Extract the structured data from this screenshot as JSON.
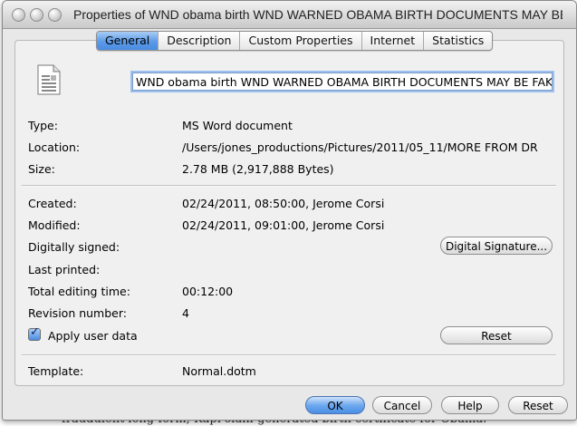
{
  "window": {
    "title": "Properties of WND obama birth WND WARNED OBAMA BIRTH DOCUMENTS MAY BE F..."
  },
  "tabs": [
    {
      "label": "General",
      "active": true
    },
    {
      "label": "Description",
      "active": false
    },
    {
      "label": "Custom Properties",
      "active": false
    },
    {
      "label": "Internet",
      "active": false
    },
    {
      "label": "Statistics",
      "active": false
    }
  ],
  "document": {
    "icon": "document-icon",
    "name_value": "WND obama birth WND WARNED OBAMA BIRTH DOCUMENTS MAY BE FAKE"
  },
  "info": {
    "type_label": "Type:",
    "type_value": "MS Word document",
    "location_label": "Location:",
    "location_value": "/Users/jones_productions/Pictures/2011/05_11/MORE FROM DR",
    "size_label": "Size:",
    "size_value": "2.78 MB (2,917,888 Bytes)"
  },
  "dates": {
    "created_label": "Created:",
    "created_value": "02/24/2011, 08:50:00, Jerome Corsi",
    "modified_label": "Modified:",
    "modified_value": "02/24/2011, 09:01:00, Jerome Corsi",
    "signed_label": "Digitally signed:",
    "signature_button": "Digital Signature...",
    "printed_label": "Last printed:",
    "editing_label": "Total editing time:",
    "editing_value": "00:12:00",
    "revision_label": "Revision number:",
    "revision_value": "4",
    "apply_user_data_label": "Apply user data",
    "apply_user_data_checked": true,
    "reset_label": "Reset"
  },
  "template": {
    "label": "Template:",
    "value": "Normal.dotm"
  },
  "footer": {
    "ok": "OK",
    "cancel": "Cancel",
    "help": "Help",
    "reset": "Reset"
  },
  "background_text": "fraudulent long-form, Kapi'olani-generated birth certificate for Obama."
}
